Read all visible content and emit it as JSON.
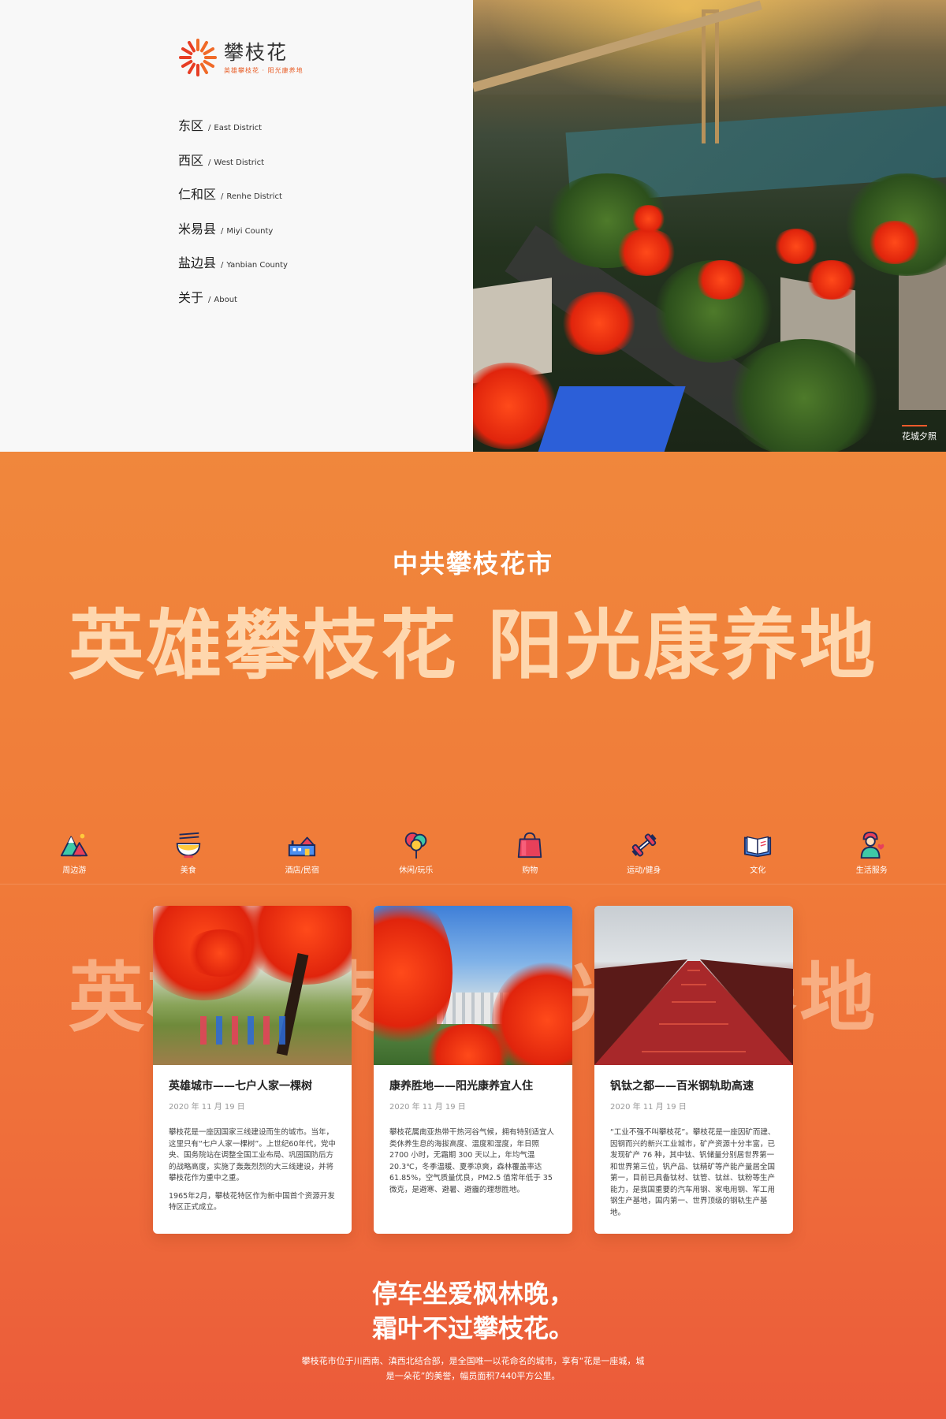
{
  "logo": {
    "title": "攀枝花",
    "subtitle": "英雄攀枝花 · 阳光康养地"
  },
  "nav": [
    {
      "cn": "东区",
      "en": "East District"
    },
    {
      "cn": "西区",
      "en": "West District"
    },
    {
      "cn": "仁和区",
      "en": "Renhe District"
    },
    {
      "cn": "米易县",
      "en": "Miyi County"
    },
    {
      "cn": "盐边县",
      "en": "Yanbian County"
    },
    {
      "cn": "关于",
      "en": "About"
    }
  ],
  "hero": {
    "caption": "花城夕照"
  },
  "banner": {
    "subtitle": "中共攀枝花市",
    "slogan": "英雄攀枝花 阳光康养地",
    "ghost_slogan": "英雄攀枝花 阳光康养地"
  },
  "categories": [
    {
      "label": "周边游",
      "icon": "mountain-icon"
    },
    {
      "label": "美食",
      "icon": "noodle-bowl-icon"
    },
    {
      "label": "酒店/民宿",
      "icon": "hotel-icon"
    },
    {
      "label": "休闲/玩乐",
      "icon": "balloon-icon"
    },
    {
      "label": "购物",
      "icon": "shopping-bag-icon"
    },
    {
      "label": "运动/健身",
      "icon": "dumbbell-icon"
    },
    {
      "label": "文化",
      "icon": "book-icon"
    },
    {
      "label": "生活服务",
      "icon": "service-person-icon"
    }
  ],
  "cards": [
    {
      "title": "英雄城市——七户人家一棵树",
      "date": "2020 年 11 月 19 日",
      "text": "攀枝花是一座因国家三线建设而生的城市。当年，这里只有“七户人家一棵树”。上世纪60年代，党中央、国务院站在调整全国工业布局、巩固国防后方的战略高度，实施了轰轰烈烈的大三线建设，并将攀枝花作为重中之重。",
      "text2": "1965年2月，攀枝花特区作为新中国首个资源开发特区正式成立。"
    },
    {
      "title": "康养胜地——阳光康养宜人住",
      "date": "2020 年 11 月 19 日",
      "text": "攀枝花属南亚热带干热河谷气候，拥有特别适宜人类休养生息的海拔高度、温度和湿度，年日照 2700 小时，无霜期 300 天以上，年均气温 20.3℃，冬季温暖、夏季凉爽，森林覆盖率达 61.85%，空气质量优良，PM2.5 值常年低于 35 微克，是避寒、避暑、避霾的理想胜地。",
      "text2": ""
    },
    {
      "title": "钒钛之都——百米钢轨助高速",
      "date": "2020 年 11 月 19 日",
      "text": "“工业不强不叫攀枝花”。攀枝花是一座因矿而建、因钢而兴的新兴工业城市，矿产资源十分丰富，已发现矿产 76 种，其中钛、钒储量分别居世界第一和世界第三位，钒产品、钛精矿等产能产量居全国第一，目前已具备钛材、钛管、钛丝、钛粉等生产能力，是我国重要的汽车用钢、家电用钢、军工用钢生产基地，国内第一、世界顶级的钢轨生产基地。",
      "text2": ""
    }
  ],
  "poem": {
    "line1": "停车坐爱枫林晚，",
    "line2": "霜叶不过攀枝花。"
  },
  "description": "攀枝花市位于川西南、滇西北结合部，是全国唯一以花命名的城市，享有“花是一座城，城是一朵花”的美誉，幅员面积7440平方公里。",
  "colors": {
    "accent": "#f25a2b",
    "orange_top": "#f0873c",
    "orange_bottom": "#eb5a3a"
  }
}
